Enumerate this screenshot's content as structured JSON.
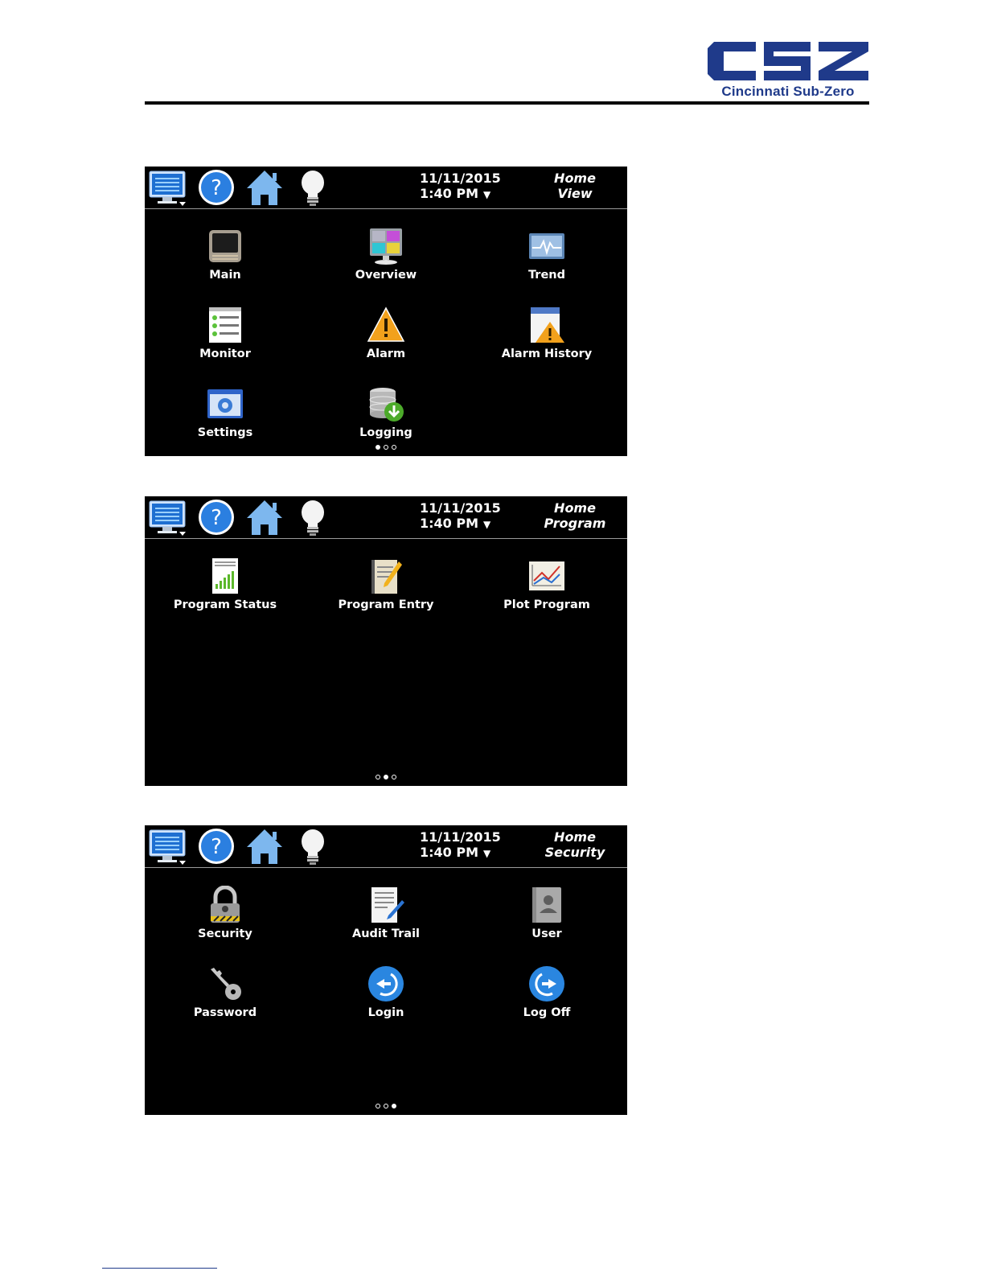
{
  "brand": {
    "name": "Cincinnati Sub-Zero",
    "logo_letters": "CSZ",
    "color": "#1f3a8a"
  },
  "screens": [
    {
      "datetime": {
        "date": "11/11/2015",
        "time": "1:40 PM",
        "arrow": "▼"
      },
      "breadcrumb": {
        "line1": "Home",
        "line2": "View"
      },
      "items": [
        {
          "label": "Main",
          "icon": "main-display-icon"
        },
        {
          "label": "Overview",
          "icon": "overview-monitor-icon"
        },
        {
          "label": "Trend",
          "icon": "trend-graph-icon"
        },
        {
          "label": "Monitor",
          "icon": "monitor-list-icon"
        },
        {
          "label": "Alarm",
          "icon": "alarm-warning-icon"
        },
        {
          "label": "Alarm History",
          "icon": "alarm-history-icon"
        },
        {
          "label": "Settings",
          "icon": "settings-gear-icon"
        },
        {
          "label": "Logging",
          "icon": "logging-database-icon"
        }
      ],
      "pager": {
        "active": 0,
        "count": 3
      }
    },
    {
      "datetime": {
        "date": "11/11/2015",
        "time": "1:40 PM",
        "arrow": "▼"
      },
      "breadcrumb": {
        "line1": "Home",
        "line2": "Program"
      },
      "items": [
        {
          "label": "Program Status",
          "icon": "program-status-icon"
        },
        {
          "label": "Program Entry",
          "icon": "program-entry-icon"
        },
        {
          "label": "Plot Program",
          "icon": "plot-program-icon"
        }
      ],
      "pager": {
        "active": 1,
        "count": 3
      }
    },
    {
      "datetime": {
        "date": "11/11/2015",
        "time": "1:40 PM",
        "arrow": "▼"
      },
      "breadcrumb": {
        "line1": "Home",
        "line2": "Security"
      },
      "items": [
        {
          "label": "Security",
          "icon": "security-padlock-icon"
        },
        {
          "label": "Audit Trail",
          "icon": "audit-trail-icon"
        },
        {
          "label": "User",
          "icon": "user-book-icon"
        },
        {
          "label": "Password",
          "icon": "password-key-icon"
        },
        {
          "label": "Login",
          "icon": "login-arrow-icon"
        },
        {
          "label": "Log Off",
          "icon": "logoff-arrow-icon"
        }
      ],
      "pager": {
        "active": 2,
        "count": 3
      }
    }
  ]
}
